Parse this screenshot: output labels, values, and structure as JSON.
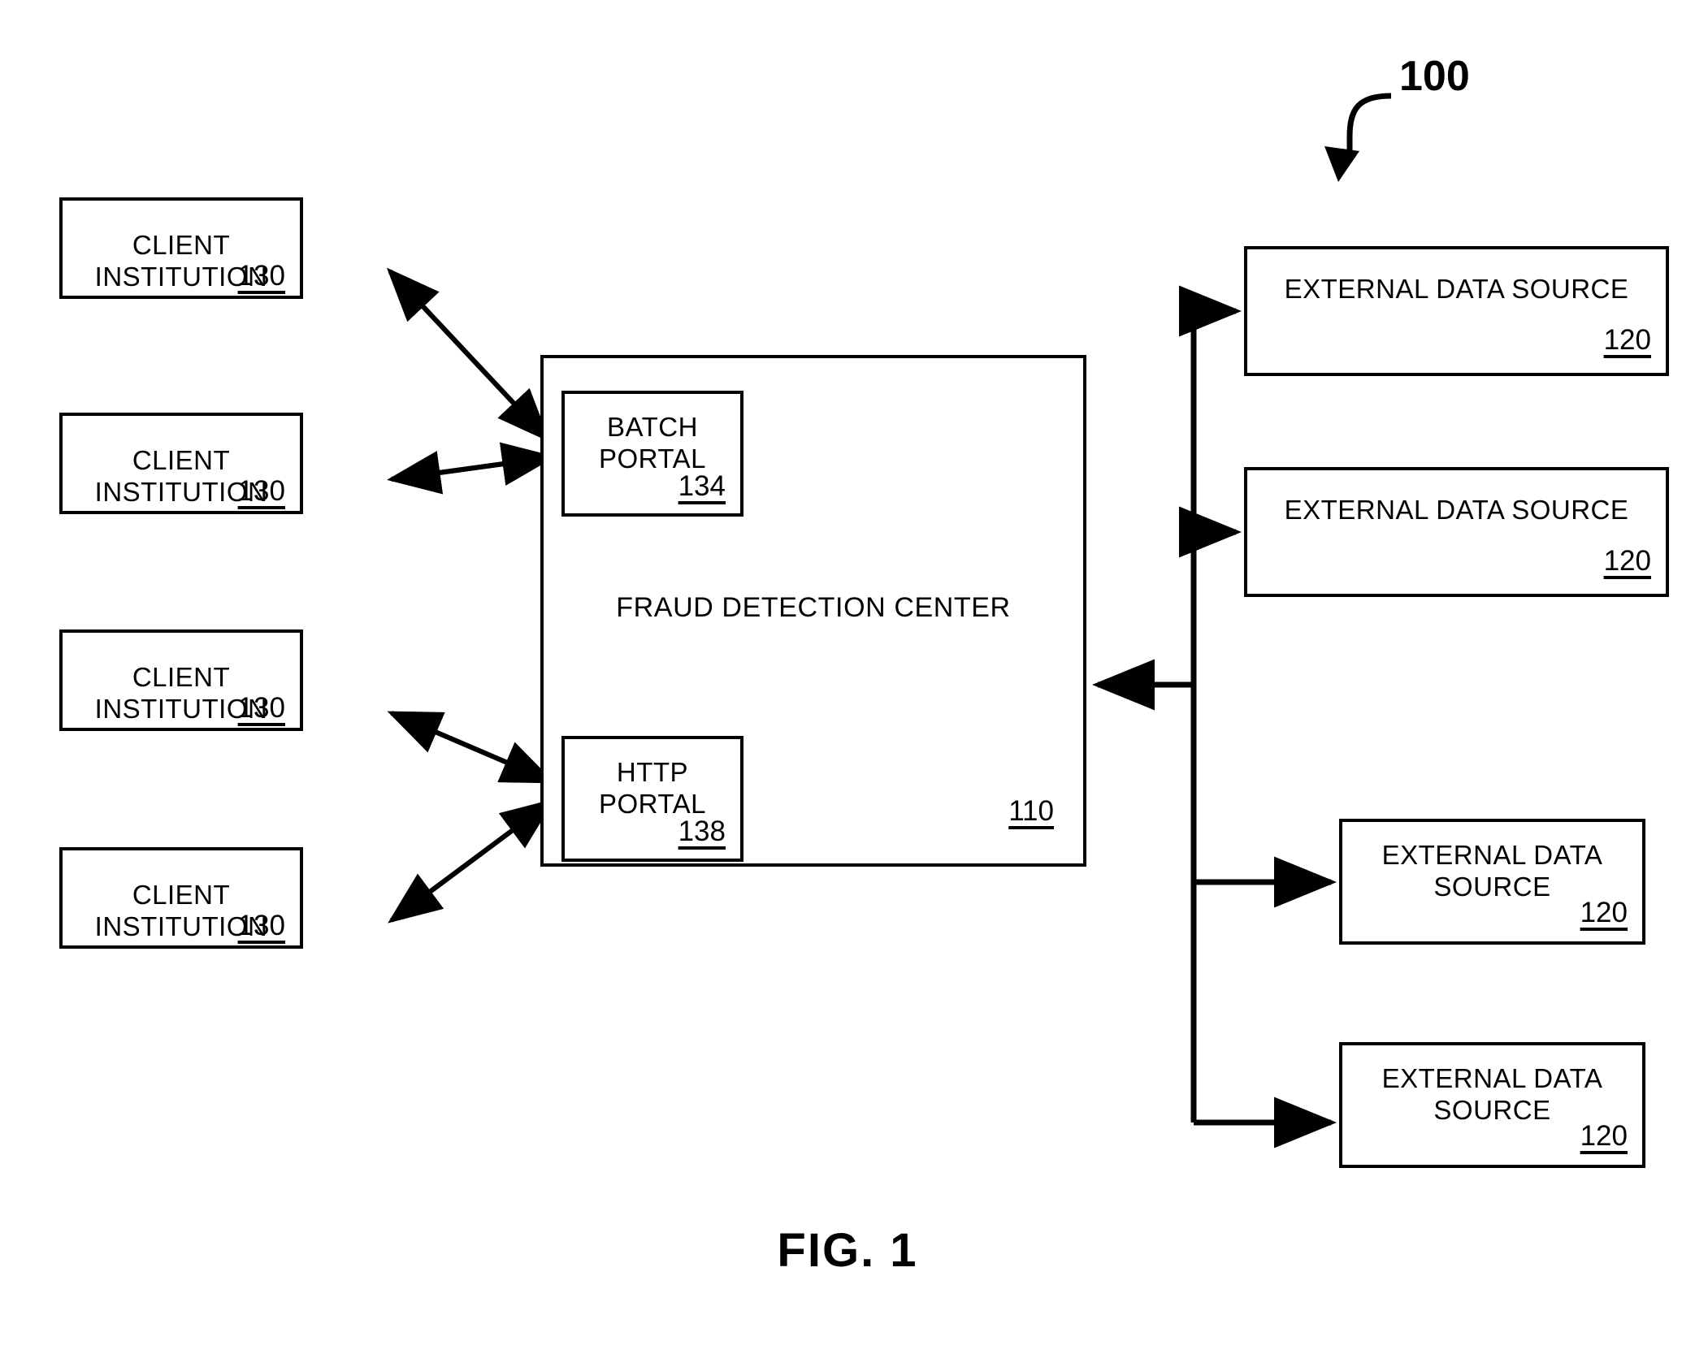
{
  "figure": {
    "caption": "FIG. 1",
    "system_reference": "100",
    "line_color": "#000000",
    "background_color": "#ffffff"
  },
  "fraud_center": {
    "title": "FRAUD DETECTION CENTER",
    "ref": "110",
    "portals": [
      {
        "label": "BATCH\nPORTAL",
        "ref": "134"
      },
      {
        "label": "HTTP\nPORTAL",
        "ref": "138"
      }
    ]
  },
  "client_institutions": [
    {
      "label": "CLIENT INSTITUTION",
      "ref": "130"
    },
    {
      "label": "CLIENT INSTITUTION",
      "ref": "130"
    },
    {
      "label": "CLIENT INSTITUTION",
      "ref": "130"
    },
    {
      "label": "CLIENT INSTITUTION",
      "ref": "130"
    }
  ],
  "external_data_sources": [
    {
      "label": "EXTERNAL DATA SOURCE",
      "ref": "120"
    },
    {
      "label": "EXTERNAL DATA SOURCE",
      "ref": "120"
    },
    {
      "label": "EXTERNAL DATA\nSOURCE",
      "ref": "120"
    },
    {
      "label": "EXTERNAL DATA\nSOURCE",
      "ref": "120"
    }
  ]
}
